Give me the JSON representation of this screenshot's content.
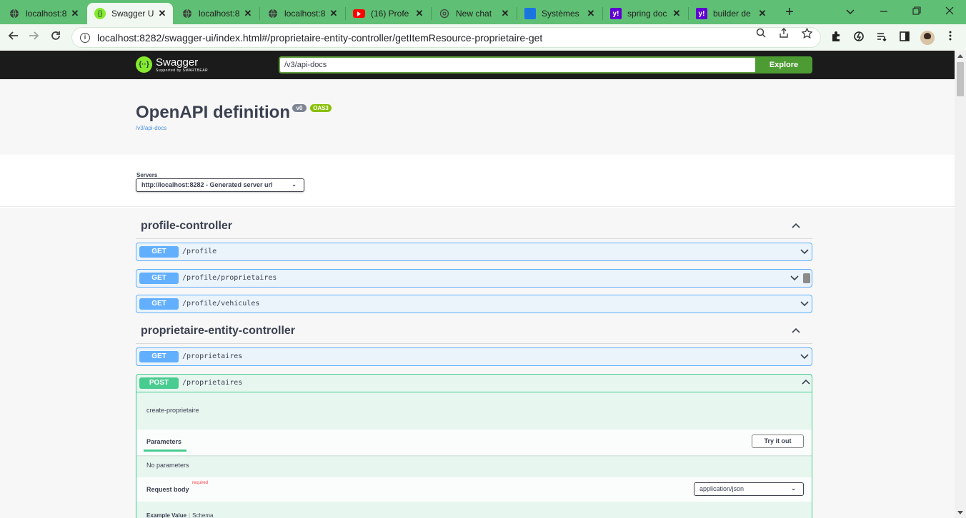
{
  "browser": {
    "tabs": [
      {
        "title": "localhost:8",
        "icon": "globe-icon",
        "active": false
      },
      {
        "title": "Swagger U",
        "icon": "swagger-icon",
        "active": true
      },
      {
        "title": "localhost:8",
        "icon": "globe-icon",
        "active": false
      },
      {
        "title": "localhost:8",
        "icon": "globe-icon",
        "active": false
      },
      {
        "title": "(16) Profe",
        "icon": "youtube-icon",
        "active": false
      },
      {
        "title": "New chat",
        "icon": "chatgpt-icon",
        "active": false
      },
      {
        "title": "Systèmes",
        "icon": "contact-icon",
        "active": false
      },
      {
        "title": "spring doc",
        "icon": "yahoo-icon",
        "active": false
      },
      {
        "title": "builder de",
        "icon": "yahoo-icon",
        "active": false
      }
    ],
    "url": "localhost:8282/swagger-ui/index.html#/proprietaire-entity-controller/getItemResource-proprietaire-get"
  },
  "swagger": {
    "logo_text": "Swagger",
    "logo_sub": "Supported by SMARTBEAR",
    "spec_url_value": "/v3/api-docs",
    "explore_label": "Explore",
    "title": "OpenAPI definition",
    "version_badge": "v0",
    "oas_badge": "OAS3",
    "spec_link": "/v3/api-docs",
    "servers_label": "Servers",
    "server_selected": "http://localhost:8282 - Generated server url"
  },
  "sections": [
    {
      "name": "profile-controller",
      "operations": [
        {
          "method": "GET",
          "path": "/profile"
        },
        {
          "method": "GET",
          "path": "/profile/proprietaires"
        },
        {
          "method": "GET",
          "path": "/profile/vehicules"
        }
      ]
    },
    {
      "name": "proprietaire-entity-controller",
      "operations": [
        {
          "method": "GET",
          "path": "/proprietaires"
        }
      ],
      "expanded_operation": {
        "method": "POST",
        "path": "/proprietaires",
        "description": "create-proprietaire",
        "parameters_tab": "Parameters",
        "try_it_out": "Try it out",
        "no_parameters": "No parameters",
        "request_body_label": "Request body",
        "required_label": "required",
        "content_type": "application/json",
        "example_tab": "Example Value",
        "schema_tab": "Schema"
      }
    }
  ],
  "colors": {
    "get": "#61affe",
    "post": "#49cc90",
    "tabbar": "#5fbf74",
    "swagger_green": "#85ea2d"
  }
}
